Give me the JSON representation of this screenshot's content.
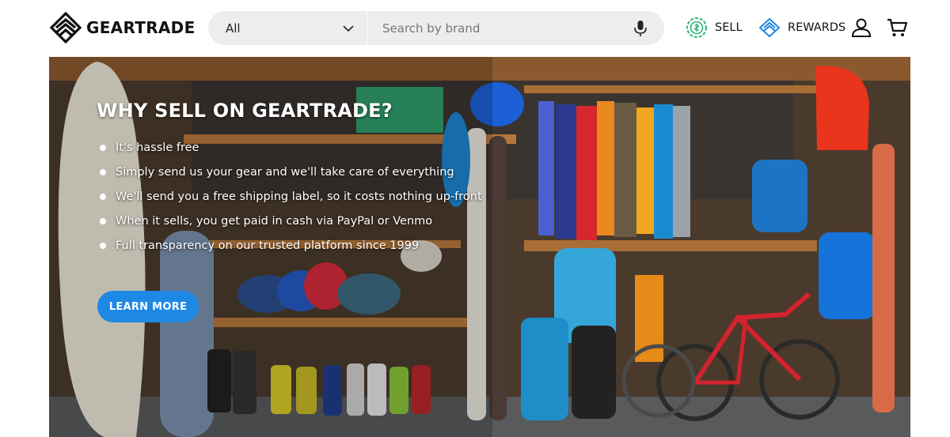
{
  "brand": {
    "name": "GEARTRADE"
  },
  "search": {
    "category_selected": "All",
    "placeholder": "Search by brand",
    "value": ""
  },
  "nav": {
    "sell_label": "SELL",
    "rewards_label": "REWARDS"
  },
  "icons": {
    "logo": "geartrade-logo-icon",
    "chevron": "chevron-down-icon",
    "mic": "microphone-icon",
    "sell": "sell-tag-icon",
    "rewards": "rewards-icon",
    "account": "account-icon",
    "cart": "cart-icon"
  },
  "colors": {
    "accent_blue": "#1e88e5",
    "sell_green": "#2bb673",
    "rewards_blue": "#1e88e5",
    "search_bg": "#ededed"
  },
  "hero": {
    "title": "WHY SELL ON GEARTRADE?",
    "bullets": [
      "It's hassle free",
      "Simply send us your gear and we'll take care of everything",
      "We'll send you a free shipping label, so it costs nothing up-front",
      "When it sells, you get paid in cash via PayPal or Venmo",
      "Full transparency on our trusted platform since 1999"
    ],
    "cta_label": "LEARN MORE"
  }
}
